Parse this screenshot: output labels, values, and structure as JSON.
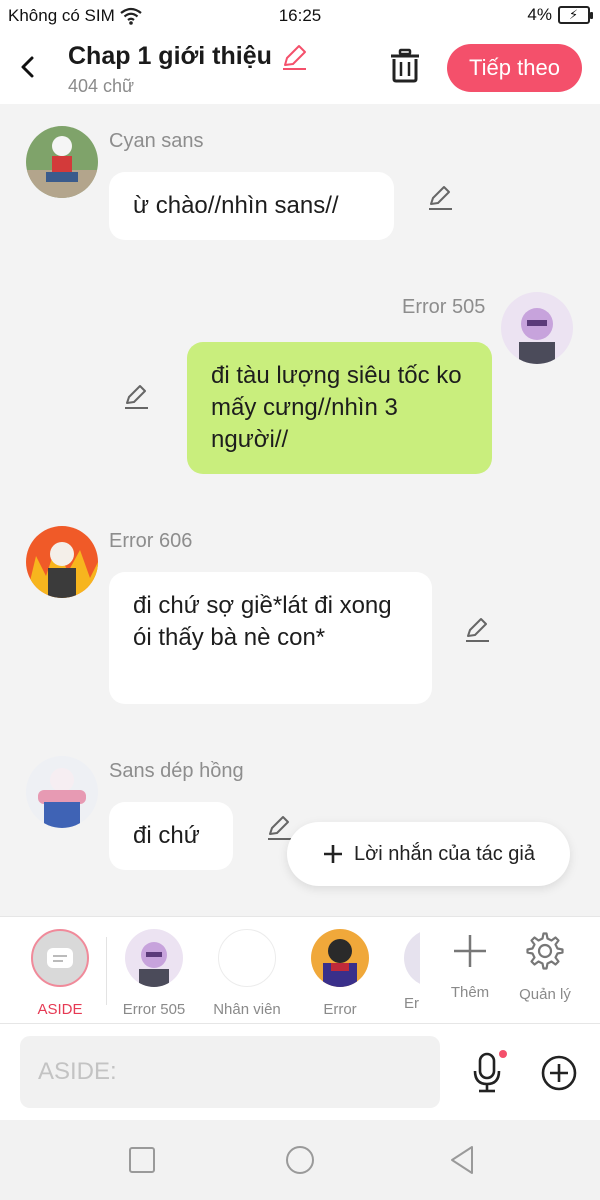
{
  "status_bar": {
    "carrier": "Không có SIM",
    "time": "16:25",
    "battery": "4%"
  },
  "header": {
    "title": "Chap 1 giới thiệu",
    "word_count": "404 chữ",
    "next_label": "Tiếp theo"
  },
  "messages": [
    {
      "sender": "Cyan sans",
      "text": "ừ chào//nhìn sans//",
      "side": "left"
    },
    {
      "sender": "Error 505",
      "text": "đi tàu lượng siêu tốc ko mấy cưng//nhìn 3 người//",
      "side": "right"
    },
    {
      "sender": "Error 606",
      "text": "đi chứ sợ giề*lát đi xong ói thấy bà nè con*",
      "side": "left"
    },
    {
      "sender": "Sans dép hồng",
      "text": "đi chứ",
      "side": "left"
    }
  ],
  "author_note_label": "Lời nhắn của tác giả",
  "characters": [
    {
      "label": "ASIDE",
      "active": true
    },
    {
      "label": "Error 505"
    },
    {
      "label": "Nhân viên"
    },
    {
      "label": "Error"
    },
    {
      "label": "Err"
    }
  ],
  "tools": {
    "add_label": "Thêm",
    "manage_label": "Quản lý"
  },
  "input": {
    "placeholder": "ASIDE:"
  },
  "colors": {
    "accent": "#f4506b",
    "right_bubble": "#c9ee7d",
    "active_label": "#e63a54"
  }
}
